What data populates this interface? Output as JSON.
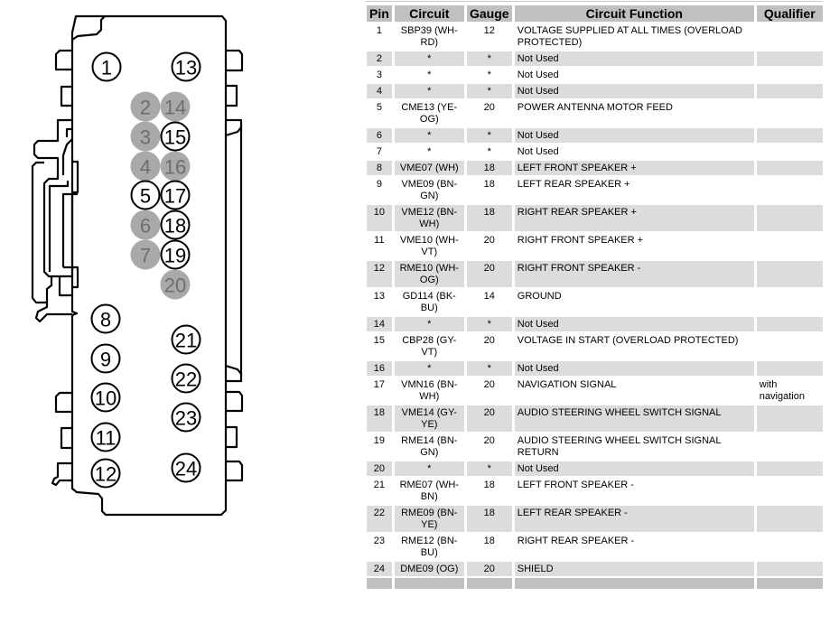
{
  "table": {
    "headers": [
      "Pin",
      "Circuit",
      "Gauge",
      "Circuit Function",
      "Qualifier"
    ],
    "rows": [
      {
        "pin": "1",
        "circuit": "SBP39 (WH-RD)",
        "gauge": "12",
        "function": "VOLTAGE SUPPLIED AT ALL TIMES (OVERLOAD PROTECTED)",
        "qualifier": ""
      },
      {
        "pin": "2",
        "circuit": "*",
        "gauge": "*",
        "function": "Not Used",
        "qualifier": ""
      },
      {
        "pin": "3",
        "circuit": "*",
        "gauge": "*",
        "function": "Not Used",
        "qualifier": ""
      },
      {
        "pin": "4",
        "circuit": "*",
        "gauge": "*",
        "function": "Not Used",
        "qualifier": ""
      },
      {
        "pin": "5",
        "circuit": "CME13 (YE-OG)",
        "gauge": "20",
        "function": "POWER ANTENNA MOTOR FEED",
        "qualifier": ""
      },
      {
        "pin": "6",
        "circuit": "*",
        "gauge": "*",
        "function": "Not Used",
        "qualifier": ""
      },
      {
        "pin": "7",
        "circuit": "*",
        "gauge": "*",
        "function": "Not Used",
        "qualifier": ""
      },
      {
        "pin": "8",
        "circuit": "VME07 (WH)",
        "gauge": "18",
        "function": "LEFT FRONT SPEAKER +",
        "qualifier": ""
      },
      {
        "pin": "9",
        "circuit": "VME09 (BN-GN)",
        "gauge": "18",
        "function": "LEFT REAR SPEAKER +",
        "qualifier": ""
      },
      {
        "pin": "10",
        "circuit": "VME12 (BN-WH)",
        "gauge": "18",
        "function": "RIGHT REAR SPEAKER +",
        "qualifier": ""
      },
      {
        "pin": "11",
        "circuit": "VME10 (WH-VT)",
        "gauge": "20",
        "function": "RIGHT FRONT SPEAKER +",
        "qualifier": ""
      },
      {
        "pin": "12",
        "circuit": "RME10 (WH-OG)",
        "gauge": "20",
        "function": "RIGHT FRONT SPEAKER -",
        "qualifier": ""
      },
      {
        "pin": "13",
        "circuit": "GD114 (BK-BU)",
        "gauge": "14",
        "function": "GROUND",
        "qualifier": ""
      },
      {
        "pin": "14",
        "circuit": "*",
        "gauge": "*",
        "function": "Not Used",
        "qualifier": ""
      },
      {
        "pin": "15",
        "circuit": "CBP28 (GY-VT)",
        "gauge": "20",
        "function": "VOLTAGE IN START (OVERLOAD PROTECTED)",
        "qualifier": ""
      },
      {
        "pin": "16",
        "circuit": "*",
        "gauge": "*",
        "function": "Not Used",
        "qualifier": ""
      },
      {
        "pin": "17",
        "circuit": "VMN16 (BN-WH)",
        "gauge": "20",
        "function": "NAVIGATION SIGNAL",
        "qualifier": "with navigation"
      },
      {
        "pin": "18",
        "circuit": "VME14 (GY-YE)",
        "gauge": "20",
        "function": "AUDIO STEERING WHEEL SWITCH SIGNAL",
        "qualifier": ""
      },
      {
        "pin": "19",
        "circuit": "RME14 (BN-GN)",
        "gauge": "20",
        "function": "AUDIO STEERING WHEEL SWITCH SIGNAL RETURN",
        "qualifier": ""
      },
      {
        "pin": "20",
        "circuit": "*",
        "gauge": "*",
        "function": "Not Used",
        "qualifier": ""
      },
      {
        "pin": "21",
        "circuit": "RME07 (WH-BN)",
        "gauge": "18",
        "function": "LEFT FRONT SPEAKER -",
        "qualifier": ""
      },
      {
        "pin": "22",
        "circuit": "RME09 (BN-YE)",
        "gauge": "18",
        "function": "LEFT REAR SPEAKER -",
        "qualifier": ""
      },
      {
        "pin": "23",
        "circuit": "RME12 (BN-BU)",
        "gauge": "18",
        "function": "RIGHT REAR SPEAKER -",
        "qualifier": ""
      },
      {
        "pin": "24",
        "circuit": "DME09 (OG)",
        "gauge": "20",
        "function": "SHIELD",
        "qualifier": ""
      }
    ]
  },
  "connector": {
    "pins": [
      {
        "label": "1",
        "used": true
      },
      {
        "label": "2",
        "used": false
      },
      {
        "label": "3",
        "used": false
      },
      {
        "label": "4",
        "used": false
      },
      {
        "label": "5",
        "used": true
      },
      {
        "label": "6",
        "used": false
      },
      {
        "label": "7",
        "used": false
      },
      {
        "label": "8",
        "used": true
      },
      {
        "label": "9",
        "used": true
      },
      {
        "label": "10",
        "used": true
      },
      {
        "label": "11",
        "used": true
      },
      {
        "label": "12",
        "used": true
      },
      {
        "label": "13",
        "used": true
      },
      {
        "label": "14",
        "used": false
      },
      {
        "label": "15",
        "used": true
      },
      {
        "label": "16",
        "used": false
      },
      {
        "label": "17",
        "used": true
      },
      {
        "label": "18",
        "used": true
      },
      {
        "label": "19",
        "used": true
      },
      {
        "label": "20",
        "used": false
      },
      {
        "label": "21",
        "used": true
      },
      {
        "label": "22",
        "used": true
      },
      {
        "label": "23",
        "used": true
      },
      {
        "label": "24",
        "used": true
      }
    ],
    "colors": {
      "outline": "#000000",
      "unused_fill": "#a9a9a9",
      "unused_text": "#6e6e6e",
      "used_fill": "#ffffff",
      "used_text": "#000000"
    }
  },
  "colors": {
    "header_bg": "#c0c0c0",
    "stripe_bg": "#dcdcdc"
  }
}
